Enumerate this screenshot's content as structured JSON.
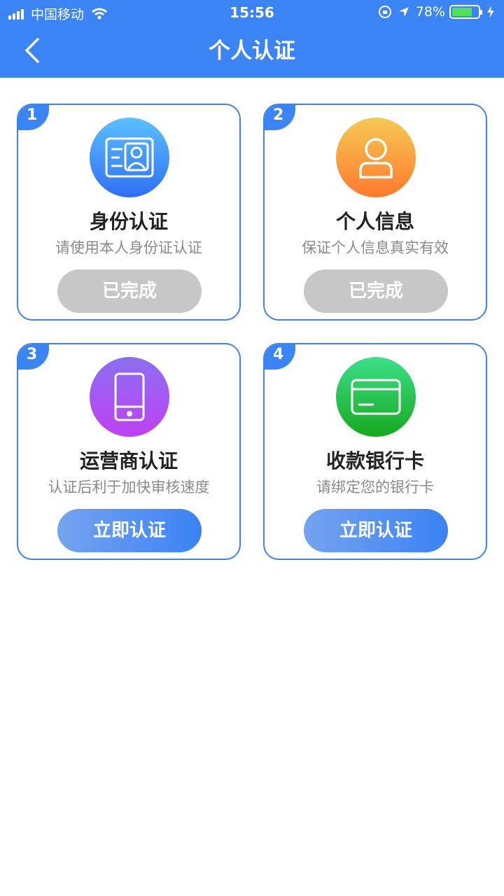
{
  "status_bar": {
    "carrier": "中国移动",
    "time": "15:56",
    "battery": "78%"
  },
  "header": {
    "title": "个人认证"
  },
  "cards": [
    {
      "number": "1",
      "title": "身份认证",
      "subtitle": "请使用本人身份证认证",
      "button": "已完成",
      "state": "done",
      "icon": "id-card-icon",
      "colors": [
        "#5cc0ff",
        "#2f6ff5"
      ]
    },
    {
      "number": "2",
      "title": "个人信息",
      "subtitle": "保证个人信息真实有效",
      "button": "已完成",
      "state": "done",
      "icon": "user-icon",
      "colors": [
        "#f5c955",
        "#ff7a2e"
      ]
    },
    {
      "number": "3",
      "title": "运营商认证",
      "subtitle": "认证后利于加快审核速度",
      "button": "立即认证",
      "state": "action",
      "icon": "phone-icon",
      "colors": [
        "#8a6ff0",
        "#c040f5"
      ]
    },
    {
      "number": "4",
      "title": "收款银行卡",
      "subtitle": "请绑定您的银行卡",
      "button": "立即认证",
      "state": "action",
      "icon": "bank-card-icon",
      "colors": [
        "#3de08a",
        "#17a81e"
      ]
    }
  ]
}
